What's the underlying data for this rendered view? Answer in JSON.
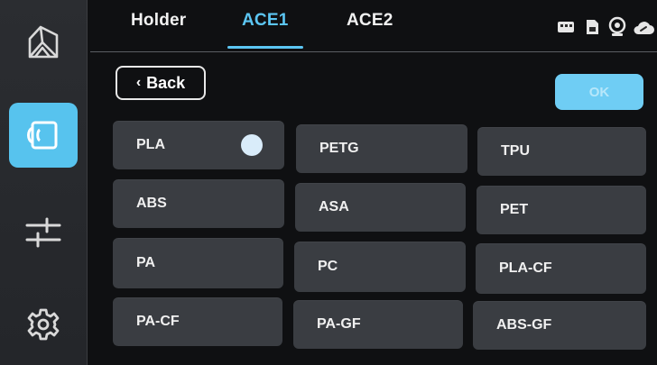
{
  "tabs": [
    {
      "label": "Holder"
    },
    {
      "label": "ACE1"
    },
    {
      "label": "ACE2"
    }
  ],
  "active_tab": "ACE1",
  "toolbar": {
    "back_label": "Back",
    "ok_label": "OK"
  },
  "sidebar": {
    "items": [
      {
        "icon": "home-icon"
      },
      {
        "icon": "filament-icon",
        "active": true
      },
      {
        "icon": "sliders-icon"
      },
      {
        "icon": "gear-icon"
      }
    ]
  },
  "status_icons": [
    "usb-icon",
    "storage-icon",
    "camera-icon",
    "cloud-link-icon"
  ],
  "materials": [
    {
      "label": "PLA",
      "selected": true
    },
    {
      "label": "PETG"
    },
    {
      "label": "TPU"
    },
    {
      "label": "ABS"
    },
    {
      "label": "ASA"
    },
    {
      "label": "PET"
    },
    {
      "label": "PA"
    },
    {
      "label": "PC"
    },
    {
      "label": "PLA-CF"
    },
    {
      "label": "PA-CF"
    },
    {
      "label": "PA-GF"
    },
    {
      "label": "ABS-GF"
    }
  ],
  "colors": {
    "accent": "#5cc6f3",
    "tile": "#3a3d42",
    "background": "#0f1012"
  }
}
